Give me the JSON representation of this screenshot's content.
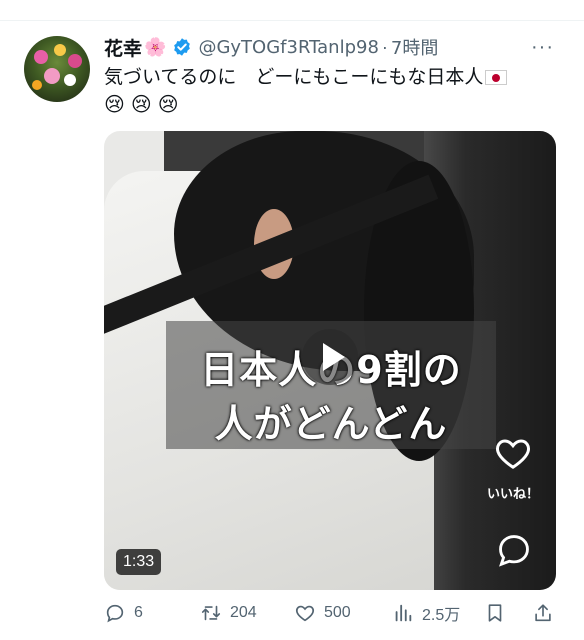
{
  "tweet": {
    "display_name": "花幸",
    "name_emoji": "🌸",
    "handle": "@GyTOGf3RTanlp98",
    "separator": "·",
    "time": "7時間",
    "more": "···",
    "text": "気づいてるのに　どーにもこーにもな日本人",
    "emojis": "😢😢😢"
  },
  "media": {
    "caption_line1": "日本人の9割の",
    "caption_line2": "人がどんどん",
    "like_label": "いいね！",
    "duration": "1:33"
  },
  "actions": {
    "replies": "6",
    "reposts": "204",
    "likes": "500",
    "views": "2.5万"
  },
  "colors": {
    "verified": "#1d9bf0",
    "muted": "#536471"
  }
}
